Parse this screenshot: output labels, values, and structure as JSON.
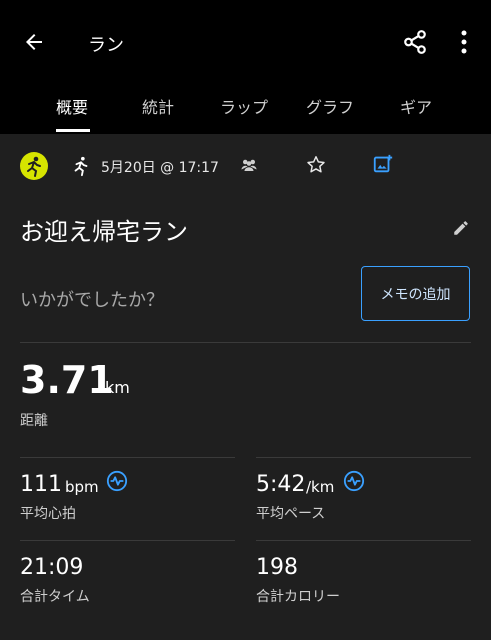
{
  "header": {
    "title": "ラン",
    "back_icon": "arrow-left-icon",
    "share_icon": "share-icon",
    "more_icon": "more-vert-icon"
  },
  "tabs": [
    {
      "label": "概要",
      "active": true
    },
    {
      "label": "統計",
      "active": false
    },
    {
      "label": "ラップ",
      "active": false
    },
    {
      "label": "グラフ",
      "active": false
    },
    {
      "label": "ギア",
      "active": false
    }
  ],
  "meta": {
    "datetime": "5月20日 @ 17:17",
    "badge_color": "#d6e400"
  },
  "activity": {
    "name": "お迎え帰宅ラン",
    "question": "いかがでしたか？",
    "memo_button": "メモの追加"
  },
  "stats": {
    "distance": {
      "value": "3.71",
      "unit": "km",
      "label": "距離"
    },
    "heart_rate": {
      "value": "111",
      "unit": "bpm",
      "label": "平均心拍"
    },
    "pace": {
      "value": "5:42",
      "unit": "/km",
      "label": "平均ペース"
    },
    "time": {
      "value": "21:09",
      "label": "合計タイム"
    },
    "calories": {
      "value": "198",
      "label": "合計カロリー"
    }
  },
  "colors": {
    "accent": "#3aa0ff",
    "background": "#1f1f1f",
    "header": "#000000"
  }
}
